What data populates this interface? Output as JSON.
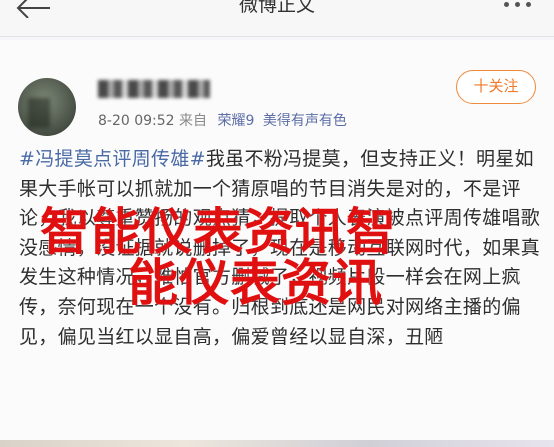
{
  "nav": {
    "title": "微博正文"
  },
  "post": {
    "time": "8-20 09:52",
    "source_prefix": "来自",
    "device": "荣耀9",
    "device_suffix": "美得有声有色",
    "follow_label": "十关注",
    "topic": "#冯提莫点评周传雄#",
    "body": "我虽不粉冯提莫，但支持正义！明星如果大手帐可以抓就加一个猜原唱的节目消失是对的，不是评论，我以尊重赞扬的观点猜，提取个人表演被点评周传雄唱歌没感情，没证据就说删掉了，现在是移动互联网时代，如果真发生这种情况，难怕官方删减了，视频片段一样会在网上疯传，奈何现在一个没有。归根到底还是网民对网络主播的偏见，偏见当红以显自高，偏爱曾经以显自深，丑陋"
  },
  "watermark": {
    "line1": "智能仪表资讯智",
    "line2": "能仪表资讯",
    "color": "#e01010"
  },
  "colors": {
    "accent": "#ef7a2a",
    "link": "#4a6aa5",
    "background": "#f6f6f8"
  }
}
